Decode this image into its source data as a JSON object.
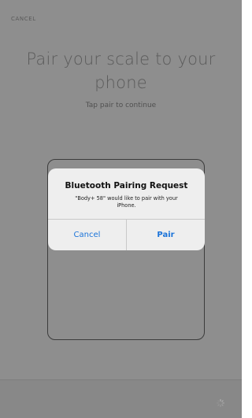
{
  "header": {
    "cancel_label": "CANCEL"
  },
  "main": {
    "title_line1": "Pair your scale to your",
    "title_line2": "phone",
    "subtitle": "Tap pair to continue"
  },
  "alert": {
    "title": "Bluetooth Pairing Request",
    "message_line1": "\"Body+ 58\" would like to pair with your",
    "message_line2": "iPhone.",
    "cancel_label": "Cancel",
    "pair_label": "Pair"
  },
  "footer": {
    "spinner_icon": "loading-spinner-icon"
  },
  "colors": {
    "background_dim": "#8e8e8e",
    "alert_background": "#eeeeee",
    "ios_blue": "#1a73d9"
  }
}
